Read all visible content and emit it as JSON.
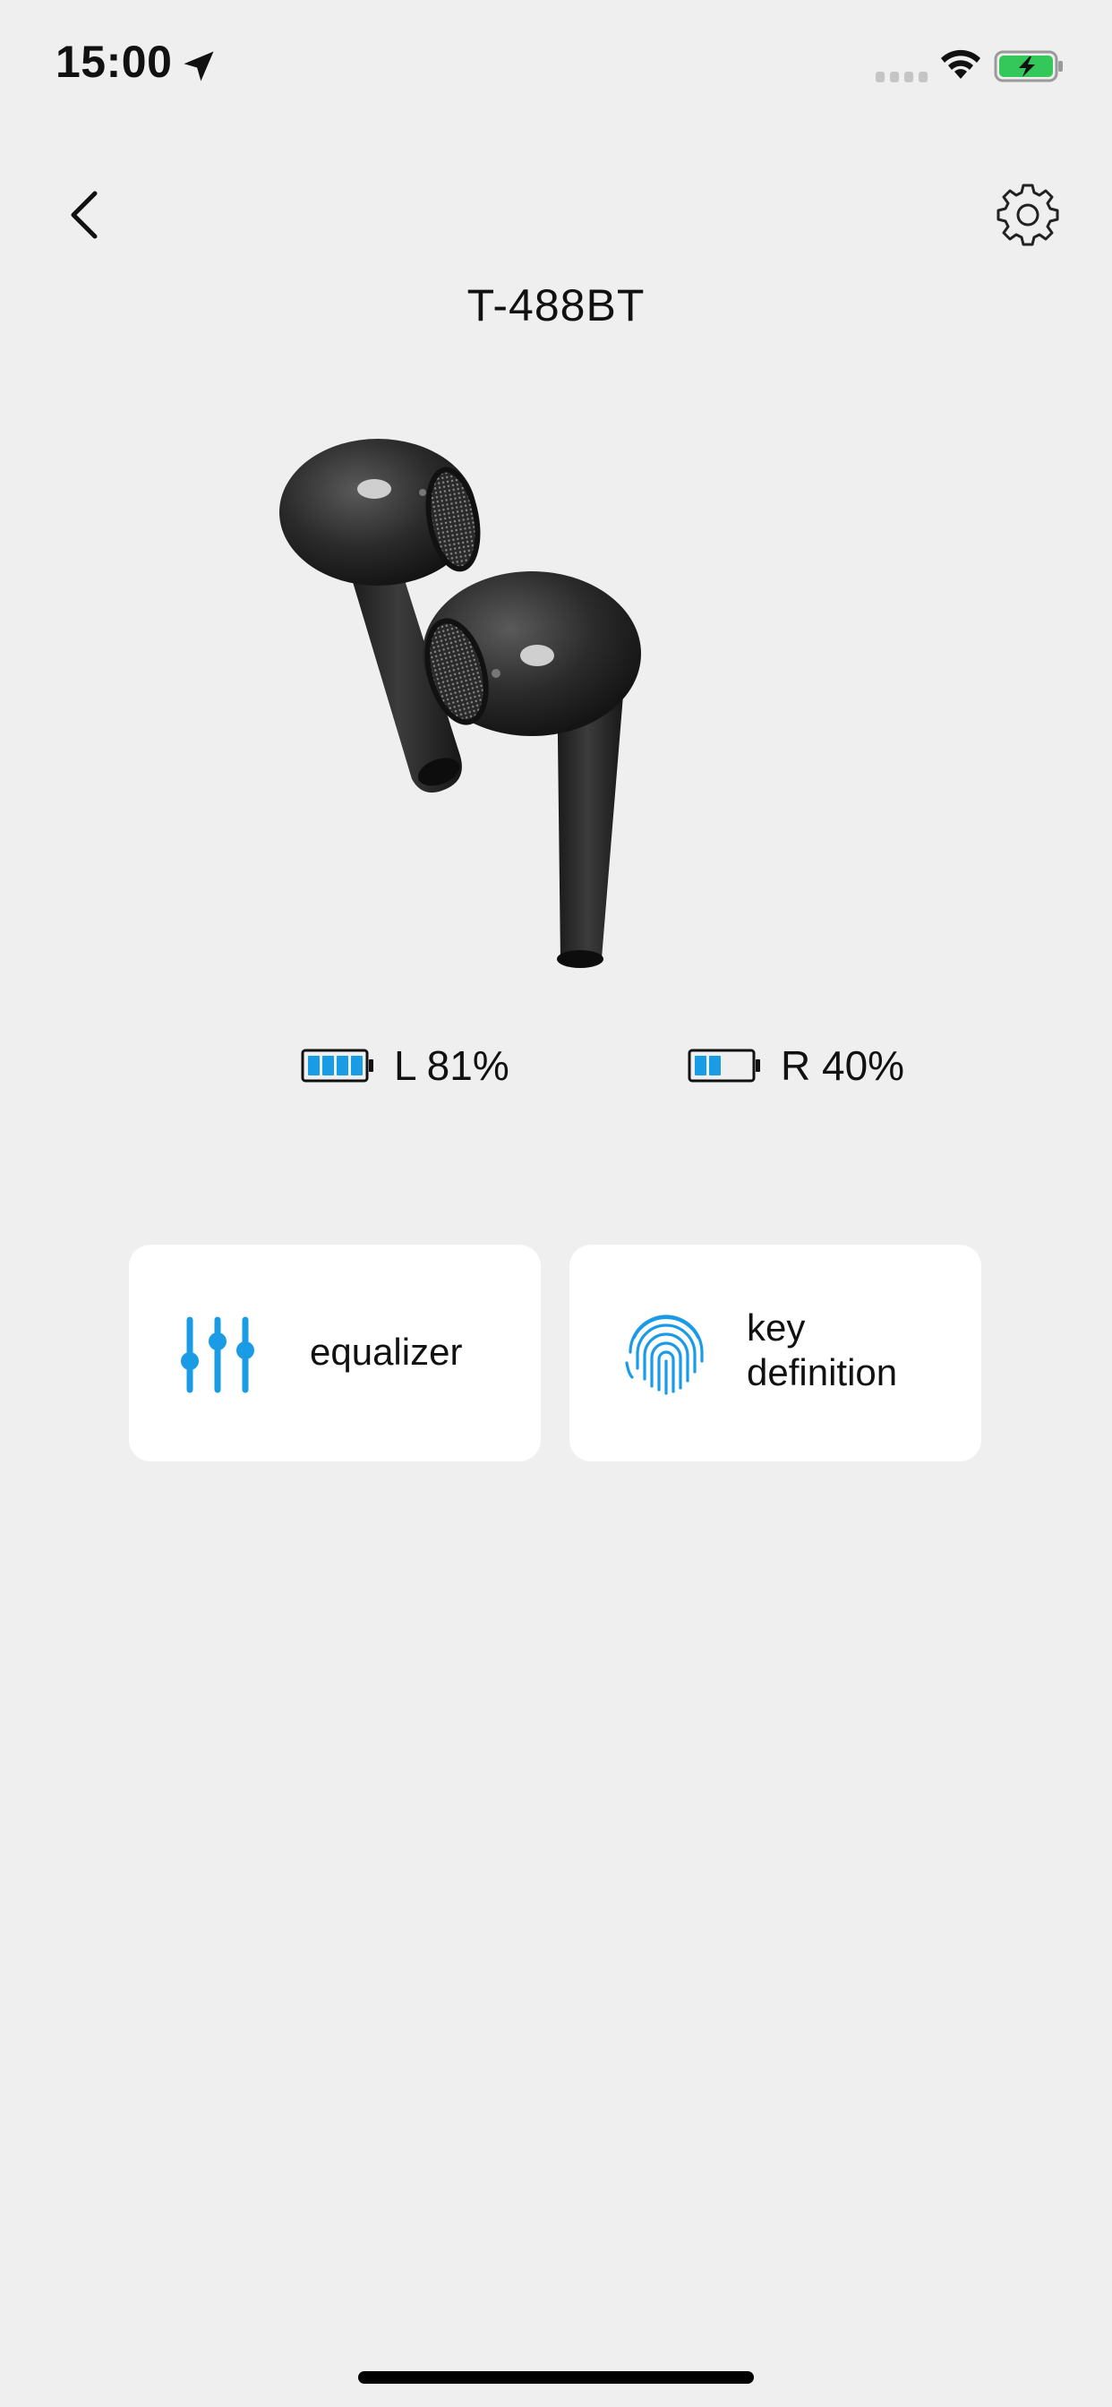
{
  "status_bar": {
    "time": "15:00",
    "icons": [
      "location-arrow-icon",
      "signal-icon",
      "wifi-icon",
      "battery-charging-icon"
    ]
  },
  "header": {
    "title": "T-488BT",
    "back_icon": "chevron-left-icon",
    "settings_icon": "gear-icon"
  },
  "battery": {
    "left": {
      "label": "L 81%",
      "level": 0.81
    },
    "right": {
      "label": "R 40%",
      "level": 0.4
    }
  },
  "features": [
    {
      "label": "equalizer",
      "icon": "equalizer-sliders-icon"
    },
    {
      "label_line1": "key",
      "label_line2": "definition",
      "icon": "fingerprint-icon"
    }
  ],
  "colors": {
    "accent": "#1a9be6",
    "background": "#efefef",
    "card": "#ffffff",
    "charging_green": "#34c759"
  }
}
